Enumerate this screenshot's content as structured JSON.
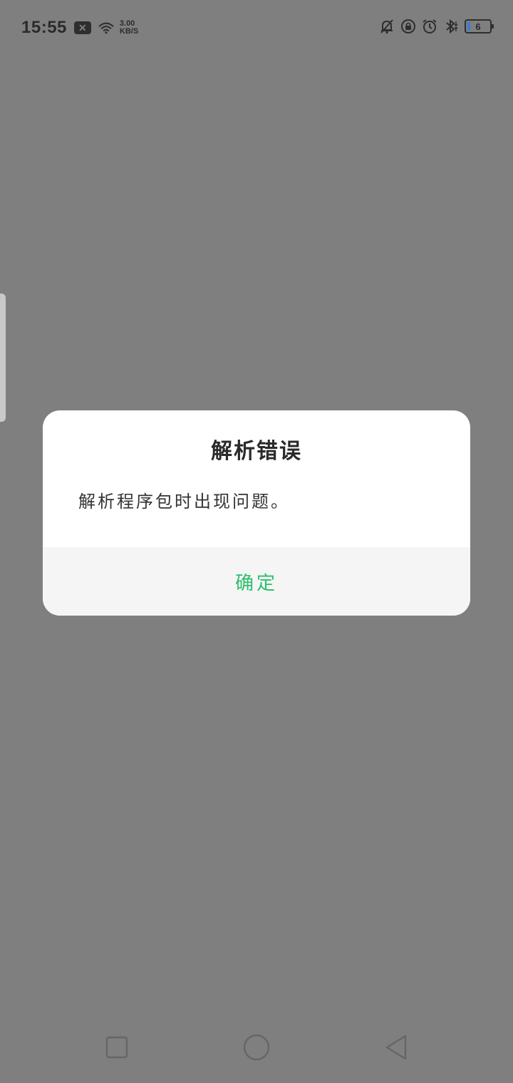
{
  "status_bar": {
    "time": "15:55",
    "x_badge": "✕",
    "net_speed_value": "3.00",
    "net_speed_unit": "KB/S",
    "battery_level": "6",
    "icons": [
      "notifications-off-icon",
      "rotation-lock-icon",
      "alarm-icon",
      "bluetooth-icon",
      "battery-icon"
    ]
  },
  "dialog": {
    "title": "解析错误",
    "message": "解析程序包时出现问题。",
    "ok_label": "确定",
    "accent_color": "#2bbf6b"
  },
  "nav_bar": {
    "icons": [
      "recents-icon",
      "home-icon",
      "back-icon"
    ]
  }
}
